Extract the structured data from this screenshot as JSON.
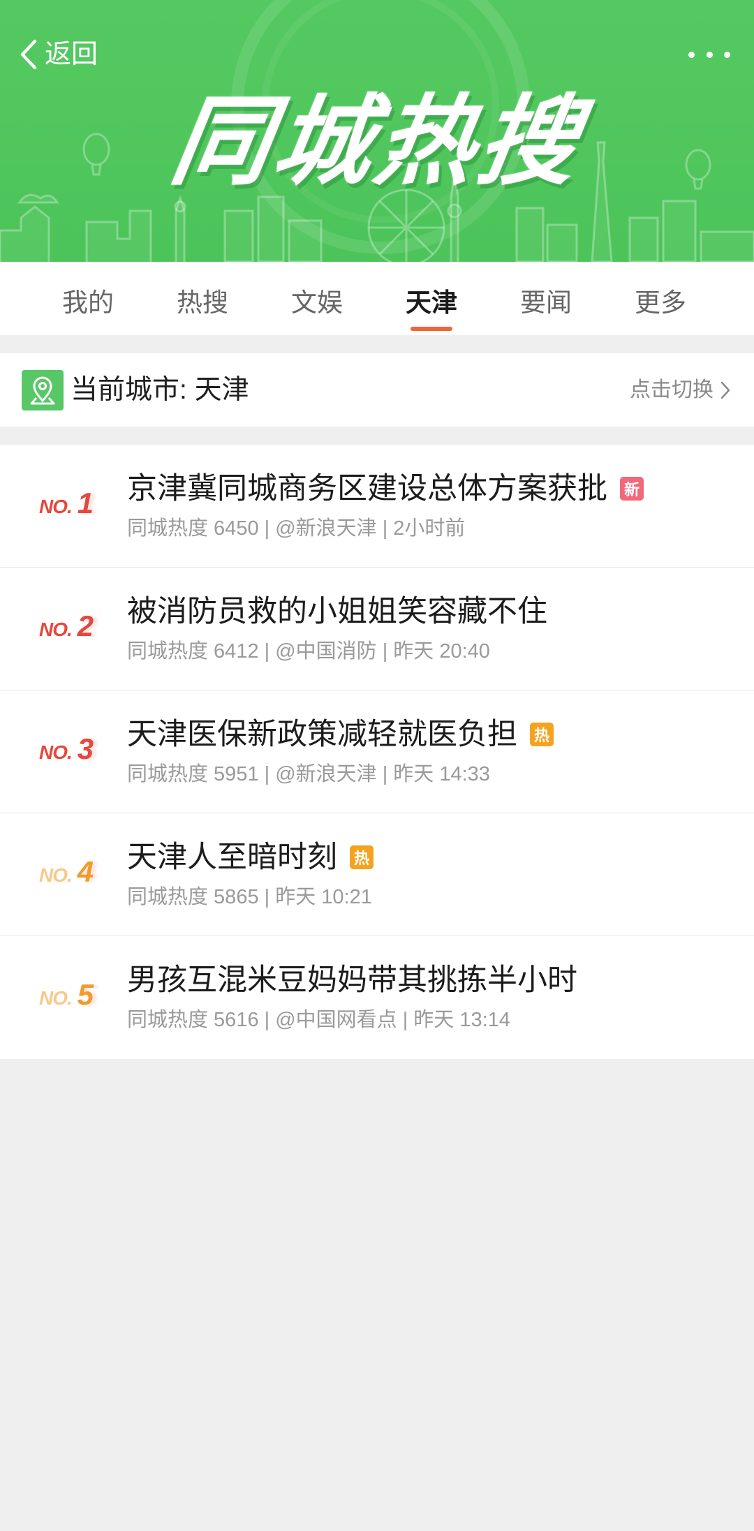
{
  "colors": {
    "header_green": "#4fc55c",
    "tab_underline": "#f0643a",
    "badge_new": "#f2687b",
    "badge_hot": "#f5a21f",
    "rank_red": "#e5483c",
    "rank_orange": "#f39a2c",
    "rank_orange_prefix": "#f7c98b",
    "page_background": "#efefef"
  },
  "header": {
    "back_icon": "chevron-left-icon",
    "back_label": "返回",
    "more_icon": "more-dots-icon",
    "title": "同城热搜"
  },
  "tabs": [
    {
      "label": "我的"
    },
    {
      "label": "热搜"
    },
    {
      "label": "文娱"
    },
    {
      "label": "天津",
      "active": true
    },
    {
      "label": "要闻"
    },
    {
      "label": "更多"
    }
  ],
  "city_bar": {
    "icon": "location-pin-icon",
    "label": "当前城市: 天津",
    "switch_label": "点击切换",
    "switch_icon": "chevron-right-icon"
  },
  "items": [
    {
      "rank_prefix": "NO.",
      "rank": "1",
      "rank_prefix_color": "#e5483c",
      "rank_color": "#e5483c",
      "title": "京津冀同城商务区建设总体方案获批",
      "badge": "新",
      "badge_color": "#f2687b",
      "meta": "同城热度 6450 | @新浪天津 | 2小时前"
    },
    {
      "rank_prefix": "NO.",
      "rank": "2",
      "rank_prefix_color": "#e5483c",
      "rank_color": "#e5483c",
      "title": "被消防员救的小姐姐笑容藏不住",
      "meta": "同城热度 6412 | @中国消防 | 昨天 20:40"
    },
    {
      "rank_prefix": "NO.",
      "rank": "3",
      "rank_prefix_color": "#e5483c",
      "rank_color": "#e5483c",
      "title": "天津医保新政策减轻就医负担",
      "badge": "热",
      "badge_color": "#f5a21f",
      "meta": "同城热度 5951 | @新浪天津 | 昨天 14:33"
    },
    {
      "rank_prefix": "NO.",
      "rank": "4",
      "rank_prefix_color": "#f7c98b",
      "rank_color": "#f39a2c",
      "title": "天津人至暗时刻",
      "badge": "热",
      "badge_color": "#f5a21f",
      "meta": "同城热度 5865 | 昨天 10:21"
    },
    {
      "rank_prefix": "NO.",
      "rank": "5",
      "rank_prefix_color": "#f7c98b",
      "rank_color": "#f39a2c",
      "title": "男孩互混米豆妈妈带其挑拣半小时",
      "meta": "同城热度 5616 | @中国网看点 | 昨天 13:14"
    }
  ]
}
